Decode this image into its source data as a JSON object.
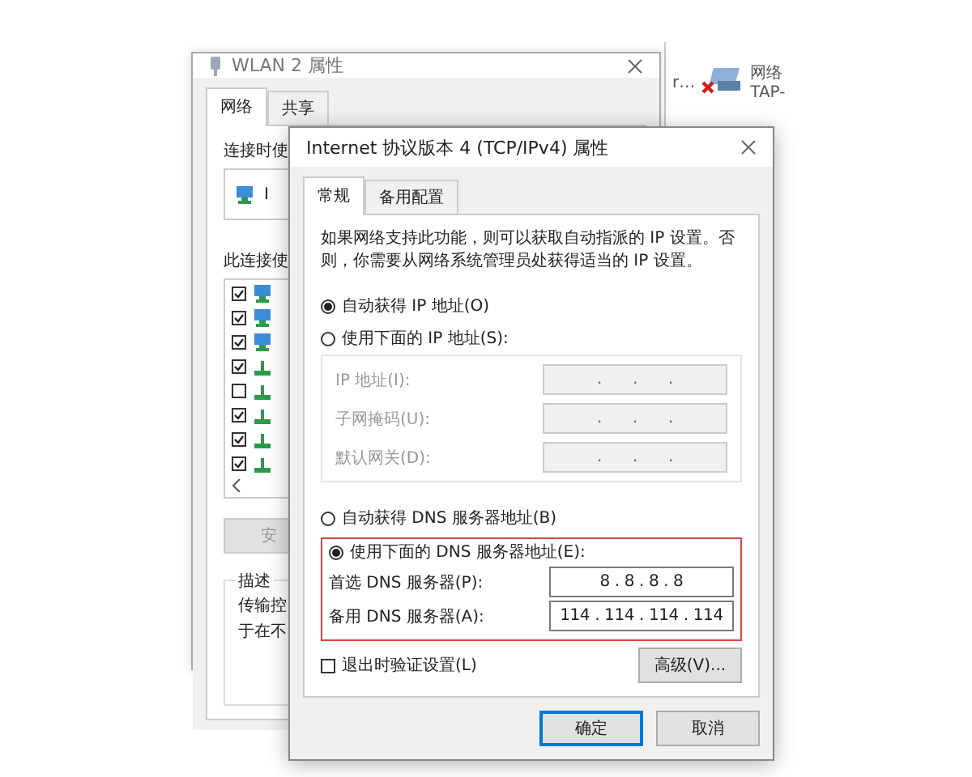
{
  "network_window": {
    "cut_text": "r…",
    "adapter_name": "网络",
    "adapter_desc": "TAP-"
  },
  "wlan_window": {
    "title": "WLAN 2 属性",
    "tabs": [
      {
        "label": "网络",
        "selected": true
      },
      {
        "label": "共享",
        "selected": false
      }
    ],
    "connect_using_label": "连接时使",
    "adapter_text": "I",
    "items_label": "此连接使",
    "components": [
      {
        "kind": "client",
        "checked": true
      },
      {
        "kind": "client",
        "checked": true
      },
      {
        "kind": "client",
        "checked": true
      },
      {
        "kind": "protocol",
        "checked": true
      },
      {
        "kind": "protocol",
        "checked": false
      },
      {
        "kind": "protocol",
        "checked": true
      },
      {
        "kind": "protocol",
        "checked": true
      },
      {
        "kind": "protocol",
        "checked": true
      }
    ],
    "install_button": "安",
    "description_label": "描述",
    "description_lines": [
      "传输控",
      "于在不"
    ]
  },
  "dialog": {
    "title": "Internet 协议版本 4 (TCP/IPv4) 属性",
    "tabs": [
      {
        "label": "常规",
        "selected": true
      },
      {
        "label": "备用配置",
        "selected": false
      }
    ],
    "intro": "如果网络支持此功能，则可以获取自动指派的 IP 设置。否则，你需要从网络系统管理员处获得适当的 IP 设置。",
    "ip_options": [
      {
        "label": "自动获得 IP 地址(O)",
        "selected": true
      },
      {
        "label": "使用下面的 IP 地址(S):",
        "selected": false
      }
    ],
    "ip_fields": [
      {
        "label": "IP 地址(I):",
        "value": ". . .",
        "disabled": true
      },
      {
        "label": "子网掩码(U):",
        "value": ". . .",
        "disabled": true
      },
      {
        "label": "默认网关(D):",
        "value": ". . .",
        "disabled": true
      }
    ],
    "dns_options": [
      {
        "label": "自动获得 DNS 服务器地址(B)",
        "selected": false
      },
      {
        "label": "使用下面的 DNS 服务器地址(E):",
        "selected": true
      }
    ],
    "dns_fields": [
      {
        "label": "首选 DNS 服务器(P):",
        "value": "8 . 8 . 8 . 8",
        "disabled": false
      },
      {
        "label": "备用 DNS 服务器(A):",
        "value": "114 . 114 . 114 . 114",
        "disabled": false
      }
    ],
    "validate_checkbox": {
      "label": "退出时验证设置(L)",
      "checked": false
    },
    "advanced_button": "高级(V)...",
    "buttons": [
      {
        "label": "确定",
        "default": true
      },
      {
        "label": "取消",
        "default": false
      }
    ]
  }
}
